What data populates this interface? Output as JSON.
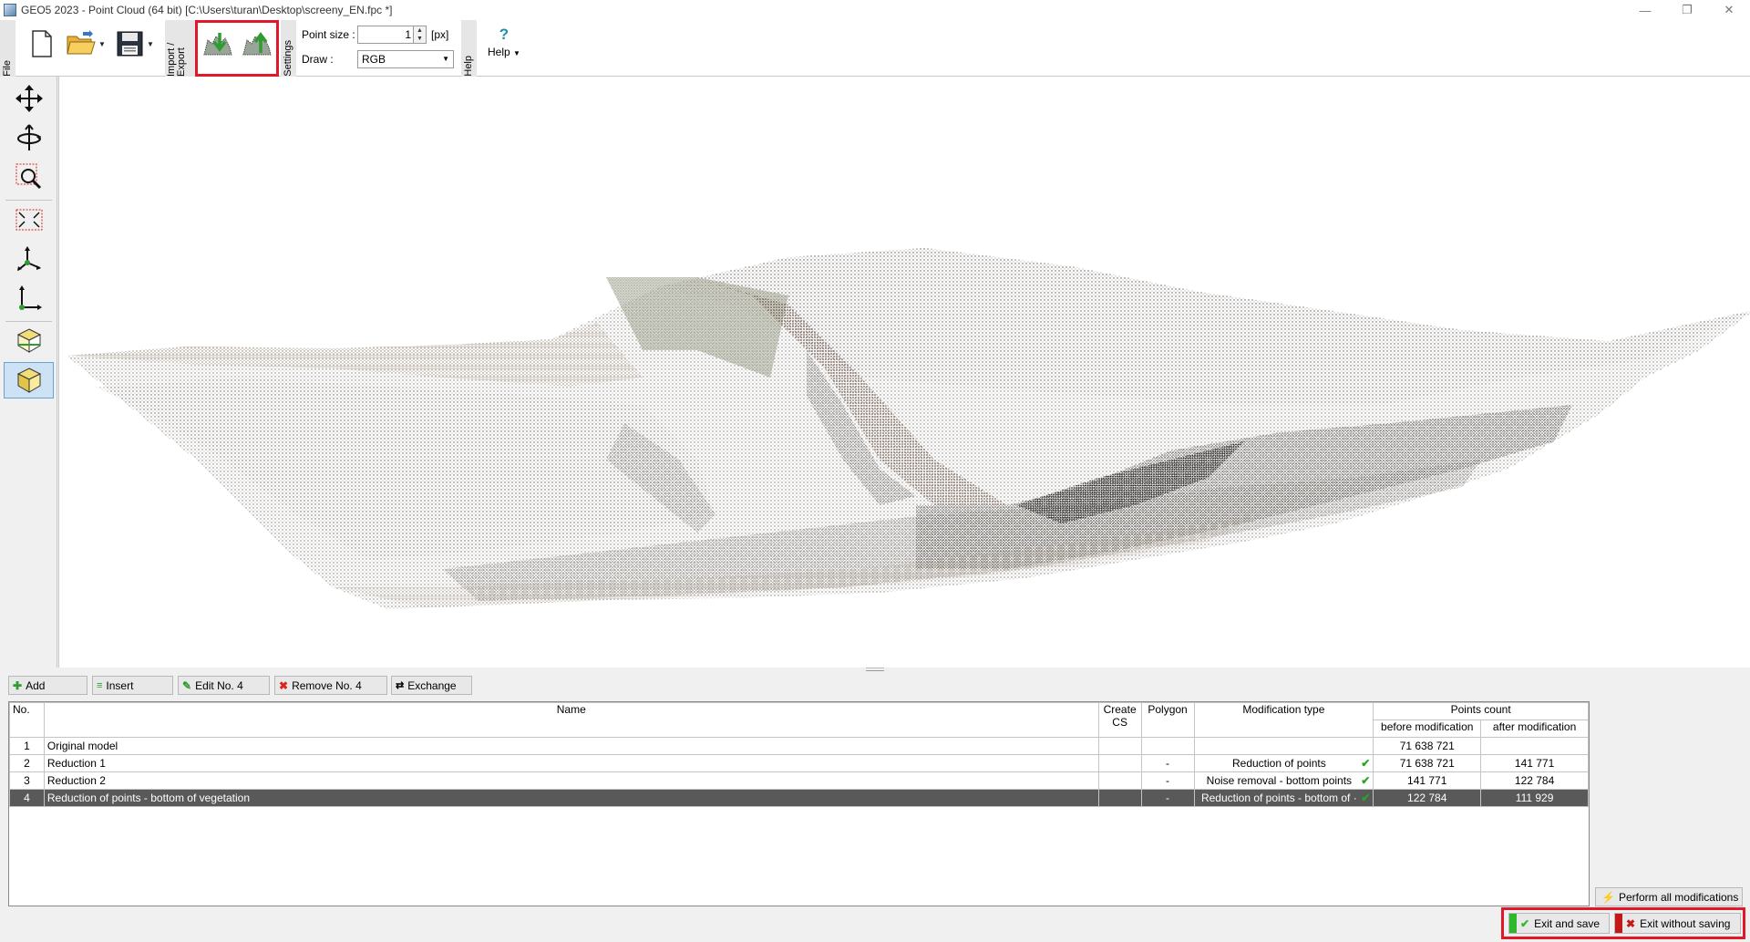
{
  "window": {
    "title": "GEO5 2023 - Point Cloud (64 bit) [C:\\Users\\turan\\Desktop\\screeny_EN.fpc *]",
    "controls": {
      "minimize": "—",
      "restore": "❐",
      "close": "✕"
    }
  },
  "ribbon": {
    "tab_file": "File",
    "tab_import_export": "Import / Export",
    "tab_settings": "Settings",
    "tab_help": "Help",
    "point_size_label": "Point size :",
    "point_size_value": "1",
    "point_size_unit": "[px]",
    "draw_label": "Draw :",
    "draw_value": "RGB",
    "help_icon": "?",
    "help_label": "Help"
  },
  "bottom_toolbar": {
    "add": "Add",
    "insert": "Insert",
    "edit": "Edit No. 4",
    "remove": "Remove No. 4",
    "exchange": "Exchange"
  },
  "table": {
    "headers": {
      "no": "No.",
      "name": "Name",
      "create_cs_1": "Create",
      "create_cs_2": "CS",
      "polygon": "Polygon",
      "modification_type": "Modification type",
      "points_count": "Points count",
      "before": "before modification",
      "after": "after modification"
    },
    "rows": [
      {
        "no": "1",
        "name": "Original model",
        "create_cs": "",
        "polygon": "",
        "modification": "",
        "check": "",
        "before": "71 638 721",
        "after": ""
      },
      {
        "no": "2",
        "name": "Reduction 1",
        "create_cs": "",
        "polygon": "-",
        "modification": "Reduction of points",
        "check": "✔",
        "before": "71 638 721",
        "after": "141 771"
      },
      {
        "no": "3",
        "name": "Reduction 2",
        "create_cs": "",
        "polygon": "-",
        "modification": "Noise removal - bottom points",
        "check": "✔",
        "before": "141 771",
        "after": "122 784"
      },
      {
        "no": "4",
        "name": "Reduction of points - bottom of vegetation",
        "create_cs": "",
        "polygon": "-",
        "modification": "Reduction of points - bottom of ·",
        "check": "✔",
        "before": "122 784",
        "after": "111 929"
      }
    ]
  },
  "footer": {
    "perform_all": "Perform all modifications",
    "exit_save": "Exit and save",
    "exit_nosave": "Exit without saving"
  },
  "colors": {
    "highlight": "#e0182a",
    "selected_row": "#595959",
    "check": "#28a428",
    "save_green": "#2db82d",
    "nosave_red": "#c41818"
  }
}
